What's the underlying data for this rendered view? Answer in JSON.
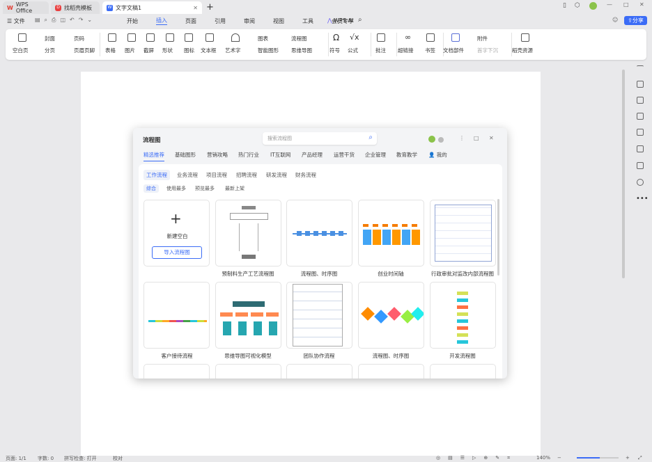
{
  "titlebar": {
    "tabs": [
      {
        "label": "WPS Office"
      },
      {
        "label": "找稻壳模板"
      },
      {
        "label": "文字文稿1"
      }
    ],
    "new_tab": "+"
  },
  "menu": {
    "file": "文件",
    "items": [
      "开始",
      "插入",
      "页面",
      "引用",
      "审阅",
      "视图",
      "工具",
      "会员专享"
    ],
    "active": "插入",
    "ai": "WPS AI",
    "share": "分享"
  },
  "ribbon": {
    "items": [
      "空白页",
      "封面",
      "分页",
      "页码",
      "页眉页脚",
      "表格",
      "图片",
      "截屏",
      "形状",
      "图标",
      "文本框",
      "艺术字",
      "图表",
      "智能图形",
      "流程图",
      "思维导图",
      "符号",
      "公式",
      "批注",
      "超链接",
      "书签",
      "文档部件",
      "附件",
      "首字下沉",
      "稻壳资源"
    ]
  },
  "dialog": {
    "title": "流程图",
    "search_placeholder": "搜索流程图",
    "categories": [
      "精选推荐",
      "基础图形",
      "营销攻略",
      "热门行业",
      "IT互联网",
      "产品经理",
      "运营干货",
      "企业管理",
      "教育教学",
      "我的"
    ],
    "active_category": "精选推荐",
    "subtabs": [
      "工作流程",
      "业务流程",
      "项目流程",
      "招聘流程",
      "研发流程",
      "财务流程"
    ],
    "active_subtab": "工作流程",
    "sort": [
      "综合",
      "使用最多",
      "预览最多",
      "最新上架"
    ],
    "active_sort": "综合",
    "new_blank": "新建空白",
    "import": "导入流程图",
    "templates": [
      "预制料生产工艺流程图",
      "流程图、时序图",
      "创业时间轴",
      "行政审批对监改内部流程图",
      "客户接待流程",
      "思维导图可视化模型",
      "团队协作流程",
      "流程图、时序图",
      "开发流程图"
    ]
  },
  "status": {
    "page": "页面: 1/1",
    "words": "字数: 0",
    "spell": "拼写检查: 打开",
    "proof": "校对",
    "zoom": "140%"
  },
  "colors": {
    "accent": "#3b6cf6",
    "share_bg": "#3b6cf6"
  }
}
